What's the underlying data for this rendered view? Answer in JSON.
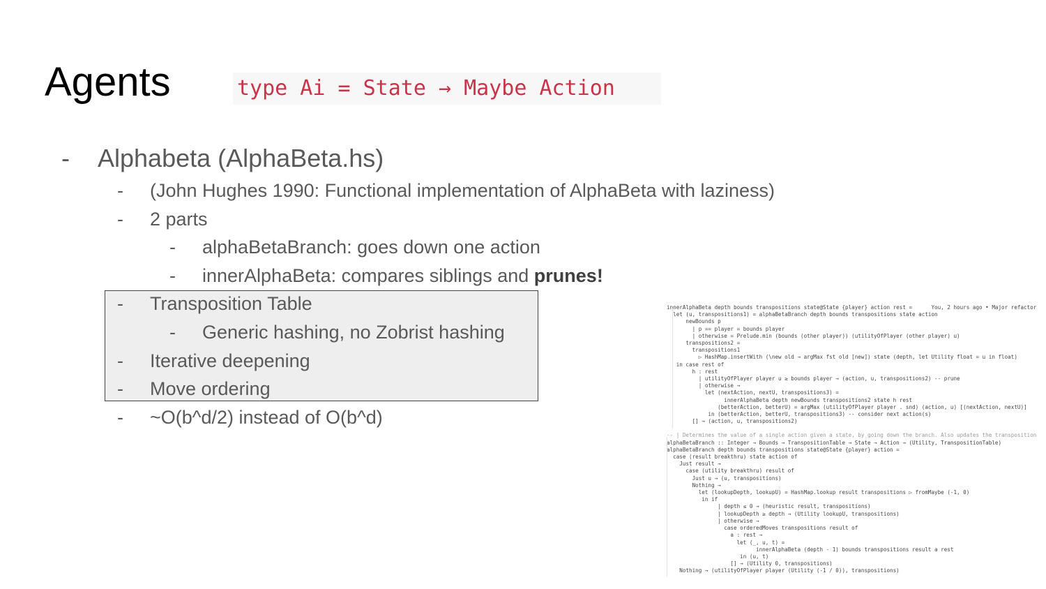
{
  "slide": {
    "title": "Agents",
    "type_signature": "type Ai = State → Maybe Action",
    "bullets": [
      {
        "dash": "-",
        "text": "Alphabeta (AlphaBeta.hs)"
      },
      {
        "dash": "-",
        "text": "(John Hughes 1990: Functional implementation of AlphaBeta with laziness)"
      },
      {
        "dash": "-",
        "text": "2 parts"
      },
      {
        "dash": "-",
        "text": "alphaBetaBranch: goes down one action"
      },
      {
        "dash": "-",
        "text": "innerAlphaBeta: compares siblings and ",
        "bold": "prunes!"
      },
      {
        "dash": "-",
        "text": "Transposition Table"
      },
      {
        "dash": "-",
        "text": "Generic hashing, no Zobrist hashing"
      },
      {
        "dash": "-",
        "text": "Iterative deepening"
      },
      {
        "dash": "-",
        "text": "Move ordering"
      },
      {
        "dash": "-",
        "text": "~O(b^d/2) instead of O(b^d)"
      }
    ]
  },
  "code_screenshot": {
    "lines_top": [
      "innerAlphaBeta depth bounds transpositions state@State {player} action rest =      You, 2 hours ago • Major refactor",
      "  let (u, transpositions1) = alphaBetaBranch depth bounds transpositions state action",
      "      newBounds p",
      "        | p == player = bounds player",
      "        | otherwise = Prelude.min (bounds (other player)) (utilityOfPlayer (other player) u)",
      "      transpositions2 =",
      "        transpositions1",
      "          ▷ HashMap.insertWith (\\new old → argMax fst old [new]) state (depth, let Utility float = u in float)",
      "   in case rest of",
      "        h : rest",
      "          | utilityOfPlayer player u ≥ bounds player → (action, u, transpositions2) -- prune",
      "          | otherwise →",
      "            let (nextAction, nextU, transpositions3) =",
      "                  innerAlphaBeta depth newBounds transpositions2 state h rest",
      "                (betterAction, betterU) = argMax (utilityOfPlayer player . snd) (action, u) [(nextAction, nextU)]",
      "             in (betterAction, betterU, transpositions3) -- consider next action(s)",
      "        [] → (action, u, transpositions2)"
    ],
    "lines_bottom": [
      "-- | Determines the value of a single action given a state, by going down the branch. Also updates the transposition table",
      "alphaBetaBranch :: Integer → Bounds → TranspositionTable → State → Action → (Utility, TranspositionTable)",
      "alphaBetaBranch depth bounds transpositions state@State {player} action =",
      "  case (result breakthru) state action of",
      "    Just result →",
      "      case (utility breakthru) result of",
      "        Just u → (u, transpositions)",
      "        Nothing →",
      "          let (lookupDepth, lookupU) = HashMap.lookup result transpositions ▷ fromMaybe (-1, 0)",
      "           in if",
      "                | depth ≤ 0 → (heuristic result, transpositions)",
      "                | lookupDepth ≥ depth → (Utility lookupU, transpositions)",
      "                | otherwise →",
      "                  case orderedMoves transpositions result of",
      "                    a : rest →",
      "                      let (_, u, t) =",
      "                            innerAlphaBeta (depth - 1) bounds transpositions result a rest",
      "                       in (u, t)",
      "                    [] → (Utility 0, transpositions)",
      "    Nothing → (utilityOfPlayer player (Utility (-1 / 0)), transpositions)"
    ]
  }
}
